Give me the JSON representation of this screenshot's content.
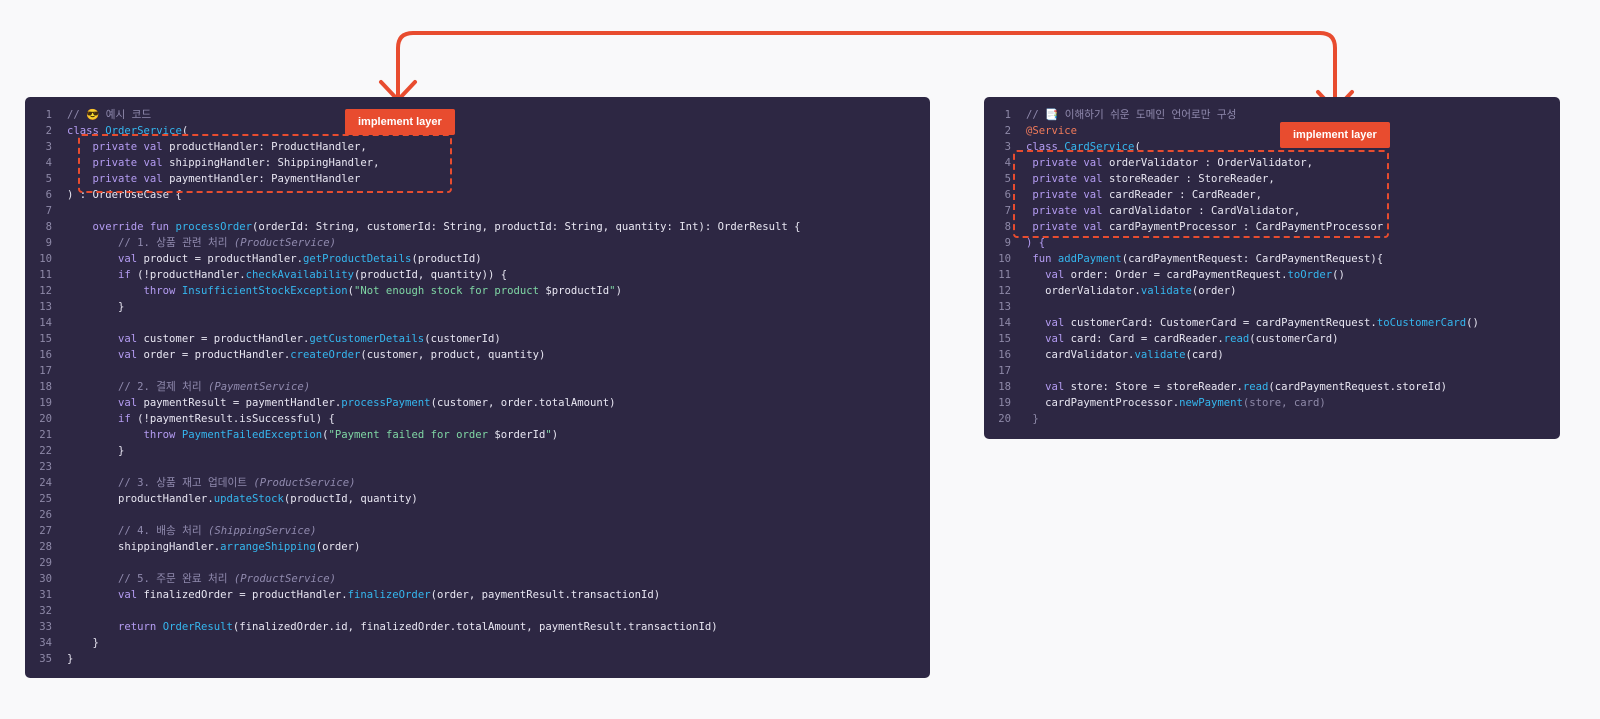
{
  "colors": {
    "panel_bg": "#2d2743",
    "accent": "#e84c2f",
    "keyword": "#b49cf2",
    "function": "#35b6ee",
    "string": "#7fd6a4",
    "comment": "#908aae"
  },
  "left_panel": {
    "tag_label": "implement layer",
    "lines": [
      {
        "n": "1",
        "t": [
          {
            "c": "cm",
            "s": "// 😎 예시 코드"
          }
        ]
      },
      {
        "n": "2",
        "t": [
          {
            "c": "kw",
            "s": "class "
          },
          {
            "c": "fn",
            "s": "OrderService"
          },
          {
            "c": "",
            "s": "("
          }
        ]
      },
      {
        "n": "3",
        "t": [
          {
            "c": "",
            "s": "    "
          },
          {
            "c": "kw",
            "s": "private val "
          },
          {
            "c": "",
            "s": "productHandler: ProductHandler,"
          }
        ]
      },
      {
        "n": "4",
        "t": [
          {
            "c": "",
            "s": "    "
          },
          {
            "c": "kw",
            "s": "private val "
          },
          {
            "c": "",
            "s": "shippingHandler: ShippingHandler,"
          }
        ]
      },
      {
        "n": "5",
        "t": [
          {
            "c": "",
            "s": "    "
          },
          {
            "c": "kw",
            "s": "private val "
          },
          {
            "c": "",
            "s": "paymentHandler: PaymentHandler"
          }
        ]
      },
      {
        "n": "6",
        "t": [
          {
            "c": "",
            "s": ") : OrderUseCase {"
          }
        ]
      },
      {
        "n": "7",
        "t": []
      },
      {
        "n": "8",
        "t": [
          {
            "c": "",
            "s": "    "
          },
          {
            "c": "kw",
            "s": "override fun "
          },
          {
            "c": "fn",
            "s": "processOrder"
          },
          {
            "c": "",
            "s": "(orderId: String, customerId: String, productId: String, quantity: Int): OrderResult {"
          }
        ]
      },
      {
        "n": "9",
        "t": [
          {
            "c": "",
            "s": "        "
          },
          {
            "c": "cm",
            "s": "// 1. 상품 관련 처리 "
          },
          {
            "c": "it",
            "s": "(ProductService)"
          }
        ]
      },
      {
        "n": "10",
        "t": [
          {
            "c": "",
            "s": "        "
          },
          {
            "c": "kw",
            "s": "val "
          },
          {
            "c": "",
            "s": "product = productHandler."
          },
          {
            "c": "fn",
            "s": "getProductDetails"
          },
          {
            "c": "",
            "s": "(productId)"
          }
        ]
      },
      {
        "n": "11",
        "t": [
          {
            "c": "",
            "s": "        "
          },
          {
            "c": "kw",
            "s": "if "
          },
          {
            "c": "",
            "s": "(!productHandler."
          },
          {
            "c": "fn",
            "s": "checkAvailability"
          },
          {
            "c": "",
            "s": "(productId, quantity)) {"
          }
        ]
      },
      {
        "n": "12",
        "t": [
          {
            "c": "",
            "s": "            "
          },
          {
            "c": "kw",
            "s": "throw "
          },
          {
            "c": "fn",
            "s": "InsufficientStockException"
          },
          {
            "c": "",
            "s": "("
          },
          {
            "c": "str",
            "s": "\"Not enough stock for product "
          },
          {
            "c": "",
            "s": "$productId"
          },
          {
            "c": "str",
            "s": "\""
          },
          {
            "c": "",
            "s": ")"
          }
        ]
      },
      {
        "n": "13",
        "t": [
          {
            "c": "",
            "s": "        }"
          }
        ]
      },
      {
        "n": "14",
        "t": []
      },
      {
        "n": "15",
        "t": [
          {
            "c": "",
            "s": "        "
          },
          {
            "c": "kw",
            "s": "val "
          },
          {
            "c": "",
            "s": "customer = productHandler."
          },
          {
            "c": "fn",
            "s": "getCustomerDetails"
          },
          {
            "c": "",
            "s": "(customerId)"
          }
        ]
      },
      {
        "n": "16",
        "t": [
          {
            "c": "",
            "s": "        "
          },
          {
            "c": "kw",
            "s": "val "
          },
          {
            "c": "",
            "s": "order = productHandler."
          },
          {
            "c": "fn",
            "s": "createOrder"
          },
          {
            "c": "",
            "s": "(customer, product, quantity)"
          }
        ]
      },
      {
        "n": "17",
        "t": []
      },
      {
        "n": "18",
        "t": [
          {
            "c": "",
            "s": "        "
          },
          {
            "c": "cm",
            "s": "// 2. 결제 처리 "
          },
          {
            "c": "it",
            "s": "(PaymentService)"
          }
        ]
      },
      {
        "n": "19",
        "t": [
          {
            "c": "",
            "s": "        "
          },
          {
            "c": "kw",
            "s": "val "
          },
          {
            "c": "",
            "s": "paymentResult = paymentHandler."
          },
          {
            "c": "fn",
            "s": "processPayment"
          },
          {
            "c": "",
            "s": "(customer, order.totalAmount)"
          }
        ]
      },
      {
        "n": "20",
        "t": [
          {
            "c": "",
            "s": "        "
          },
          {
            "c": "kw",
            "s": "if "
          },
          {
            "c": "",
            "s": "(!paymentResult.isSuccessful) {"
          }
        ]
      },
      {
        "n": "21",
        "t": [
          {
            "c": "",
            "s": "            "
          },
          {
            "c": "kw",
            "s": "throw "
          },
          {
            "c": "fn",
            "s": "PaymentFailedException"
          },
          {
            "c": "",
            "s": "("
          },
          {
            "c": "str",
            "s": "\"Payment failed for order "
          },
          {
            "c": "",
            "s": "$orderId"
          },
          {
            "c": "str",
            "s": "\""
          },
          {
            "c": "",
            "s": ")"
          }
        ]
      },
      {
        "n": "22",
        "t": [
          {
            "c": "",
            "s": "        }"
          }
        ]
      },
      {
        "n": "23",
        "t": []
      },
      {
        "n": "24",
        "t": [
          {
            "c": "",
            "s": "        "
          },
          {
            "c": "cm",
            "s": "// 3. 상품 재고 업데이트 "
          },
          {
            "c": "it",
            "s": "(ProductService)"
          }
        ]
      },
      {
        "n": "25",
        "t": [
          {
            "c": "",
            "s": "        productHandler."
          },
          {
            "c": "fn",
            "s": "updateStock"
          },
          {
            "c": "",
            "s": "(productId, quantity)"
          }
        ]
      },
      {
        "n": "26",
        "t": []
      },
      {
        "n": "27",
        "t": [
          {
            "c": "",
            "s": "        "
          },
          {
            "c": "cm",
            "s": "// 4. 배송 처리 "
          },
          {
            "c": "it",
            "s": "(ShippingService)"
          }
        ]
      },
      {
        "n": "28",
        "t": [
          {
            "c": "",
            "s": "        shippingHandler."
          },
          {
            "c": "fn",
            "s": "arrangeShipping"
          },
          {
            "c": "",
            "s": "(order)"
          }
        ]
      },
      {
        "n": "29",
        "t": []
      },
      {
        "n": "30",
        "t": [
          {
            "c": "",
            "s": "        "
          },
          {
            "c": "cm",
            "s": "// 5. 주문 완료 처리 "
          },
          {
            "c": "it",
            "s": "(ProductService)"
          }
        ]
      },
      {
        "n": "31",
        "t": [
          {
            "c": "",
            "s": "        "
          },
          {
            "c": "kw",
            "s": "val "
          },
          {
            "c": "",
            "s": "finalizedOrder = productHandler."
          },
          {
            "c": "fn",
            "s": "finalizeOrder"
          },
          {
            "c": "",
            "s": "(order, paymentResult.transactionId)"
          }
        ]
      },
      {
        "n": "32",
        "t": []
      },
      {
        "n": "33",
        "t": [
          {
            "c": "",
            "s": "        "
          },
          {
            "c": "kw",
            "s": "return "
          },
          {
            "c": "fn",
            "s": "OrderResult"
          },
          {
            "c": "",
            "s": "(finalizedOrder.id, finalizedOrder.totalAmount, paymentResult.transactionId)"
          }
        ]
      },
      {
        "n": "34",
        "t": [
          {
            "c": "",
            "s": "    }"
          }
        ]
      },
      {
        "n": "35",
        "t": [
          {
            "c": "",
            "s": "}"
          }
        ]
      }
    ]
  },
  "right_panel": {
    "tag_label": "implement layer",
    "lines": [
      {
        "n": "1",
        "t": [
          {
            "c": "cm",
            "s": "// 📑 이해하기 쉬운 도메인 언어로만 구성"
          }
        ]
      },
      {
        "n": "2",
        "t": [
          {
            "c": "an",
            "s": "@Service"
          }
        ]
      },
      {
        "n": "3",
        "t": [
          {
            "c": "kw",
            "s": "class "
          },
          {
            "c": "fn",
            "s": "CardService"
          },
          {
            "c": "",
            "s": "("
          }
        ]
      },
      {
        "n": "4",
        "t": [
          {
            "c": "",
            "s": " "
          },
          {
            "c": "kw",
            "s": "private val "
          },
          {
            "c": "",
            "s": "orderValidator : OrderValidator,"
          }
        ]
      },
      {
        "n": "5",
        "t": [
          {
            "c": "",
            "s": " "
          },
          {
            "c": "kw",
            "s": "private val "
          },
          {
            "c": "",
            "s": "storeReader : StoreReader,"
          }
        ]
      },
      {
        "n": "6",
        "t": [
          {
            "c": "",
            "s": " "
          },
          {
            "c": "kw",
            "s": "private val "
          },
          {
            "c": "",
            "s": "cardReader : CardReader,"
          }
        ]
      },
      {
        "n": "7",
        "t": [
          {
            "c": "",
            "s": " "
          },
          {
            "c": "kw",
            "s": "private val "
          },
          {
            "c": "",
            "s": "cardValidator : CardValidator,"
          }
        ]
      },
      {
        "n": "8",
        "t": [
          {
            "c": "",
            "s": " "
          },
          {
            "c": "kw",
            "s": "private val "
          },
          {
            "c": "",
            "s": "cardPaymentProcessor : CardPaymentProcessor"
          }
        ]
      },
      {
        "n": "9",
        "t": [
          {
            "c": "kw",
            "s": ") {"
          }
        ]
      },
      {
        "n": "10",
        "t": [
          {
            "c": "",
            "s": " "
          },
          {
            "c": "kw",
            "s": "fun "
          },
          {
            "c": "fn",
            "s": "addPayment"
          },
          {
            "c": "",
            "s": "(cardPaymentRequest: CardPaymentRequest){"
          }
        ]
      },
      {
        "n": "11",
        "t": [
          {
            "c": "",
            "s": "   "
          },
          {
            "c": "kw",
            "s": "val "
          },
          {
            "c": "",
            "s": "order: Order = cardPaymentRequest."
          },
          {
            "c": "fn",
            "s": "toOrder"
          },
          {
            "c": "",
            "s": "()"
          }
        ]
      },
      {
        "n": "12",
        "t": [
          {
            "c": "",
            "s": "   orderValidator."
          },
          {
            "c": "fn",
            "s": "validate"
          },
          {
            "c": "",
            "s": "(order)"
          }
        ]
      },
      {
        "n": "13",
        "t": []
      },
      {
        "n": "14",
        "t": [
          {
            "c": "",
            "s": "   "
          },
          {
            "c": "kw",
            "s": "val "
          },
          {
            "c": "",
            "s": "customerCard: CustomerCard = cardPaymentRequest."
          },
          {
            "c": "fn",
            "s": "toCustomerCard"
          },
          {
            "c": "",
            "s": "()"
          }
        ]
      },
      {
        "n": "15",
        "t": [
          {
            "c": "",
            "s": "   "
          },
          {
            "c": "kw",
            "s": "val "
          },
          {
            "c": "",
            "s": "card: Card = cardReader."
          },
          {
            "c": "fn",
            "s": "read"
          },
          {
            "c": "",
            "s": "(customerCard)"
          }
        ]
      },
      {
        "n": "16",
        "t": [
          {
            "c": "",
            "s": "   cardValidator."
          },
          {
            "c": "fn",
            "s": "validate"
          },
          {
            "c": "",
            "s": "(card)"
          }
        ]
      },
      {
        "n": "17",
        "t": []
      },
      {
        "n": "18",
        "t": [
          {
            "c": "",
            "s": "   "
          },
          {
            "c": "kw",
            "s": "val "
          },
          {
            "c": "",
            "s": "store: Store = storeReader."
          },
          {
            "c": "fn",
            "s": "read"
          },
          {
            "c": "",
            "s": "(cardPaymentRequest.storeId)"
          }
        ]
      },
      {
        "n": "19",
        "t": [
          {
            "c": "",
            "s": "   cardPaymentProcessor."
          },
          {
            "c": "fn",
            "s": "newPayment"
          },
          {
            "c": "dim",
            "s": "(store, card)"
          }
        ]
      },
      {
        "n": "20",
        "t": [
          {
            "c": "dim",
            "s": " }"
          }
        ]
      }
    ]
  }
}
